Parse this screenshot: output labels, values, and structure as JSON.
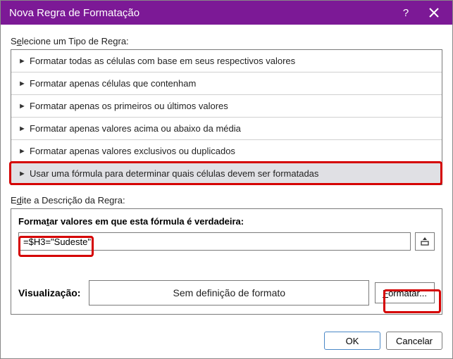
{
  "titlebar": {
    "title": "Nova Regra de Formatação"
  },
  "select_label_pre": "S",
  "select_label_ul": "e",
  "select_label_post": "lecione um Tipo de Regra:",
  "rule_types": [
    {
      "label": "Formatar todas as células com base em seus respectivos valores"
    },
    {
      "label": "Formatar apenas células que contenham"
    },
    {
      "label": "Formatar apenas os primeiros ou últimos valores"
    },
    {
      "label": "Formatar apenas valores acima ou abaixo da média"
    },
    {
      "label": "Formatar apenas valores exclusivos ou duplicados"
    },
    {
      "label": "Usar uma fórmula para determinar quais células devem ser formatadas"
    }
  ],
  "edit_label_pre": "E",
  "edit_label_ul": "d",
  "edit_label_post": "ite a Descrição da Regra:",
  "formula_head_pre": "Forma",
  "formula_head_ul": "t",
  "formula_head_post": "ar valores em que esta fórmula é verdadeira:",
  "formula_value": "=$H3=\"Sudeste\"",
  "preview_label": "Visualização:",
  "preview_text": "Sem definição de formato",
  "format_btn_ul": "F",
  "format_btn_post": "ormatar...",
  "footer": {
    "ok": "OK",
    "cancel": "Cancelar"
  }
}
